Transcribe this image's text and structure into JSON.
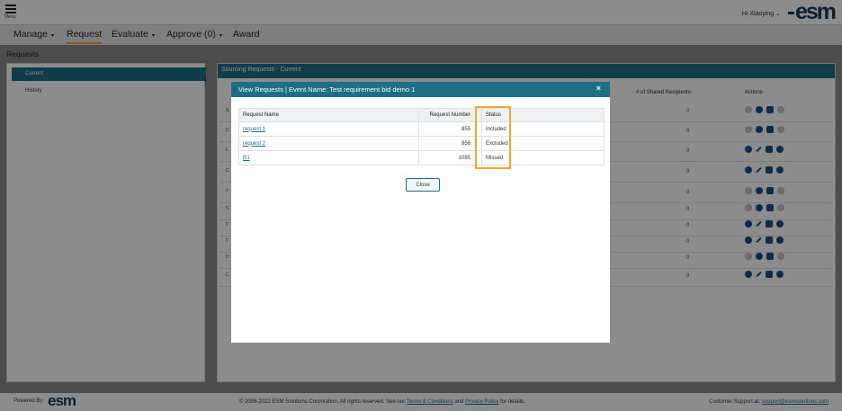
{
  "header": {
    "menu_label": "Menu",
    "greeting": "Hi Xiaoying ⌄",
    "logo": "esm"
  },
  "nav": {
    "items": [
      {
        "label": "Manage",
        "caret": "▾"
      },
      {
        "label": "Request",
        "caret": ""
      },
      {
        "label": "Evaluate",
        "caret": "▾"
      },
      {
        "label": "Approve (0)",
        "caret": "▾"
      },
      {
        "label": "Award",
        "caret": ""
      }
    ],
    "active": "Request"
  },
  "page_title": "Requests",
  "sidebar": {
    "items": [
      {
        "label": "Current"
      },
      {
        "label": "History"
      }
    ],
    "collapse_icon": "chevron-left-icon"
  },
  "main": {
    "title": "Sourcing Requests - Current",
    "columns": [
      "# of Shared Recipients",
      "Actions"
    ],
    "rows": [
      {
        "edge": "S",
        "count": "0"
      },
      {
        "edge": "C",
        "count": "0"
      },
      {
        "edge": "L",
        "count": "0"
      },
      {
        "edge": "C",
        "count": "0"
      },
      {
        "edge": "T",
        "count": "0"
      },
      {
        "edge": "S",
        "count": "0"
      },
      {
        "edge": "T",
        "count": "0"
      },
      {
        "edge": "T",
        "count": "0"
      },
      {
        "edge": "D",
        "count": "0"
      },
      {
        "edge": "C",
        "count": "0"
      }
    ]
  },
  "modal": {
    "title": "View Requests | Event Name: Test requirement bid demo 1",
    "close_icon": "×",
    "columns": [
      "Request Name",
      "Request Number",
      "Status"
    ],
    "rows": [
      {
        "name": "request 1",
        "number": "855",
        "status": "Included"
      },
      {
        "name": "request 2",
        "number": "856",
        "status": "Excluded"
      },
      {
        "name": "R1",
        "number": "1085",
        "status": "Missed"
      }
    ],
    "close_button": "Close"
  },
  "footer": {
    "powered_by": "Powered By:",
    "logo": "esm",
    "copyright_prefix": "© 2006-2022 ESM Solutions Corporation. All rights reserved. See our",
    "terms_link": "Terms & Conditions",
    "and_text": "and",
    "privacy_link": "Privacy Policy",
    "details_text": "for details.",
    "support_label": "Customer Support at:",
    "support_email": "support@esmsolutions.com"
  },
  "colors": {
    "accent": "#1e6f86",
    "highlight": "#f2a62a",
    "active_tab_underline": "#e8a33d"
  }
}
